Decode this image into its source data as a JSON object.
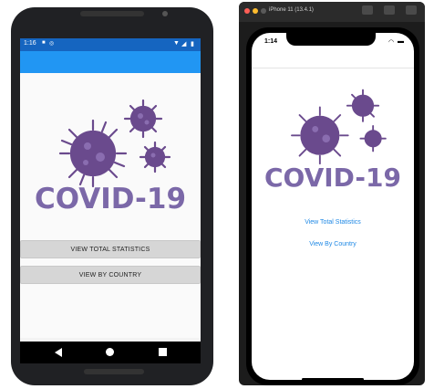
{
  "android": {
    "status": {
      "time": "1:16"
    },
    "logo_text": "COVID-19",
    "buttons": {
      "total": "VIEW TOTAL STATISTICS",
      "country": "VIEW BY COUNTRY"
    }
  },
  "ios": {
    "window_title": "iPhone 11 (13.4.1)",
    "time": "1:14",
    "logo_text": "COVID-19",
    "links": {
      "total": "View Total Statistics",
      "country": "View By Country"
    }
  },
  "colors": {
    "virus_purple": "#6a4a8d",
    "logo_purple": "#7b68a8",
    "android_primary": "#2196f3",
    "ios_link": "#1e88e5"
  }
}
